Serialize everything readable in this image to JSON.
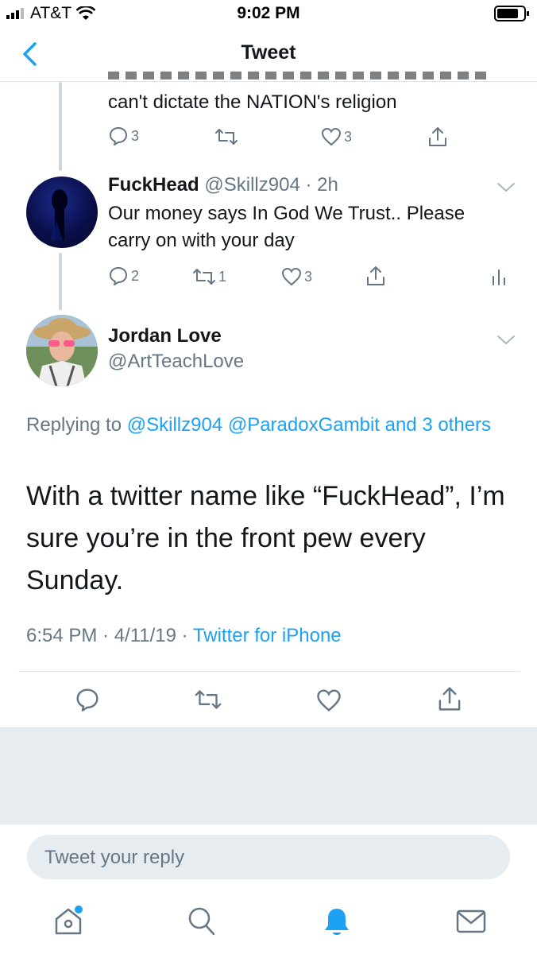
{
  "status_bar": {
    "carrier": "AT&T",
    "time": "9:02 PM"
  },
  "nav": {
    "title": "Tweet"
  },
  "thread": [
    {
      "text_partial": "can't dictate the NATION's religion",
      "reply_count": "3",
      "retweet_count": "",
      "like_count": "3"
    },
    {
      "name": "FuckHead",
      "handle": "@Skillz904",
      "time": "· 2h",
      "text": "Our money says In God We Trust.. Please carry on with your day",
      "reply_count": "2",
      "retweet_count": "1",
      "like_count": "3"
    }
  ],
  "main_tweet": {
    "name": "Jordan Love",
    "handle": "@ArtTeachLove",
    "replying_prefix": "Replying to",
    "replying_mentions": "@Skillz904 @ParadoxGambit and 3 others",
    "text": "With a twitter name like “FuckHead”, I’m sure you’re in the front pew every Sunday.",
    "time": "6:54 PM · 4/11/19 ·",
    "source": "Twitter for iPhone"
  },
  "reply": {
    "placeholder": "Tweet your reply"
  },
  "tabbar": {
    "items": [
      "home-icon",
      "search-icon",
      "notifications-icon",
      "messages-icon"
    ],
    "active": "notifications-icon",
    "accent": "#1da1f2"
  },
  "colors": {
    "accent": "#1da1f2",
    "secondary": "#657786",
    "background_gray": "#e6ecf0"
  }
}
